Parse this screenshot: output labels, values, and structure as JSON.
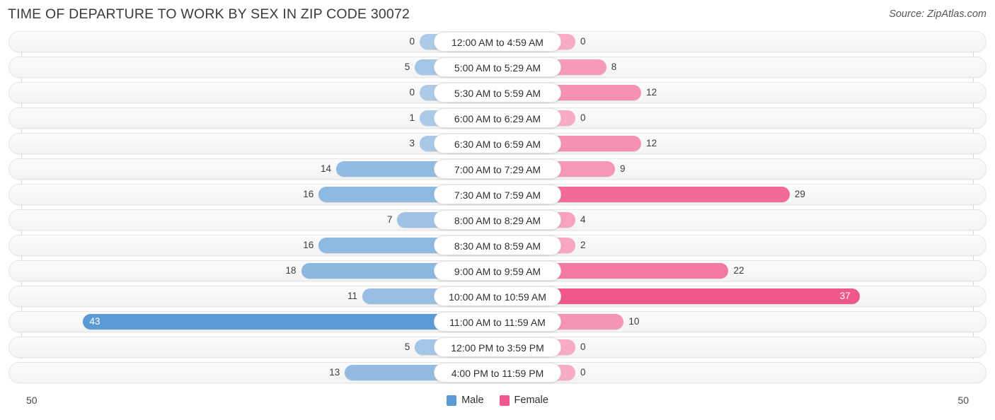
{
  "header": {
    "title": "TIME OF DEPARTURE TO WORK BY SEX IN ZIP CODE 30072",
    "source": "Source: ZipAtlas.com"
  },
  "footer": {
    "axis_left": "50",
    "axis_right": "50",
    "legend": [
      {
        "label": "Male",
        "color": "#5b9bd5"
      },
      {
        "label": "Female",
        "color": "#f2568f"
      }
    ]
  },
  "colors": {
    "male_min": "#adcbe8",
    "male_max": "#5b9bd5",
    "female_min": "#f9abc6",
    "female_max": "#ee4a84",
    "track": "#f4f4f4",
    "text": "#3c3c3c"
  },
  "chart_data": {
    "type": "bar",
    "orientation": "horizontal-diverging",
    "title": "TIME OF DEPARTURE TO WORK BY SEX IN ZIP CODE 30072",
    "xlabel": "",
    "ylabel": "",
    "xlim": [
      50,
      50
    ],
    "axis_max": 50,
    "grid": false,
    "legend_position": "bottom-center",
    "categories": [
      "12:00 AM to 4:59 AM",
      "5:00 AM to 5:29 AM",
      "5:30 AM to 5:59 AM",
      "6:00 AM to 6:29 AM",
      "6:30 AM to 6:59 AM",
      "7:00 AM to 7:29 AM",
      "7:30 AM to 7:59 AM",
      "8:00 AM to 8:29 AM",
      "8:30 AM to 8:59 AM",
      "9:00 AM to 9:59 AM",
      "10:00 AM to 10:59 AM",
      "11:00 AM to 11:59 AM",
      "12:00 PM to 3:59 PM",
      "4:00 PM to 11:59 PM"
    ],
    "series": [
      {
        "name": "Male",
        "color": "#5b9bd5",
        "values": [
          0,
          5,
          0,
          1,
          3,
          14,
          16,
          7,
          16,
          18,
          11,
          43,
          5,
          13
        ]
      },
      {
        "name": "Female",
        "color": "#f2568f",
        "values": [
          0,
          8,
          12,
          0,
          12,
          9,
          29,
          4,
          2,
          22,
          37,
          10,
          0,
          0
        ]
      }
    ]
  }
}
